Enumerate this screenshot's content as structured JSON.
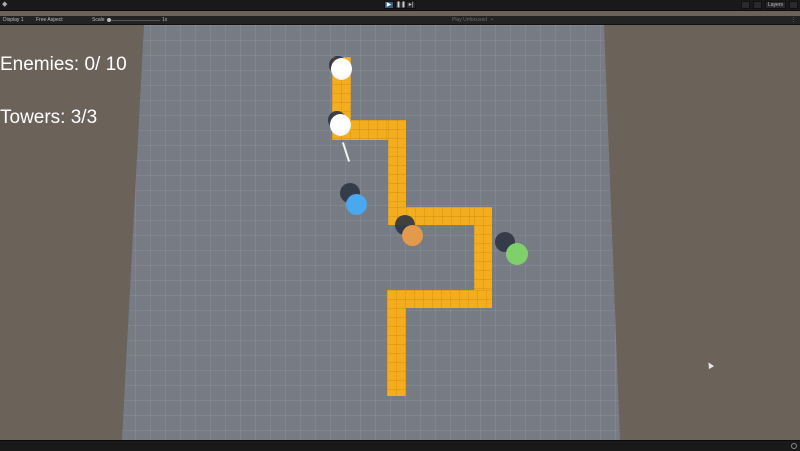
{
  "toolbar": {
    "play_icon": "play-icon",
    "pause_icon": "pause-icon",
    "step_icon": "step-icon",
    "layers_label": "Layers",
    "colors": {
      "background": "#191919",
      "play_active": "#2f5f8f"
    }
  },
  "game_view": {
    "display_label": "Display 1",
    "aspect_label": "Free Aspect",
    "scale_label": "Scale",
    "scale_value": "1x",
    "play_mode_label": "Play Unfocused"
  },
  "hud": {
    "enemies_text": "Enemies: 0/ 10",
    "towers_text": "Towers: 3/3"
  },
  "scene": {
    "colors": {
      "ground": "#777b83",
      "path": "#f4ad1e",
      "offscreen": "#6b625a",
      "enemy": "#ffffff",
      "tower_blue": "#4aa8ee",
      "tower_orange": "#e39a4c",
      "tower_green": "#7fd06a"
    }
  }
}
